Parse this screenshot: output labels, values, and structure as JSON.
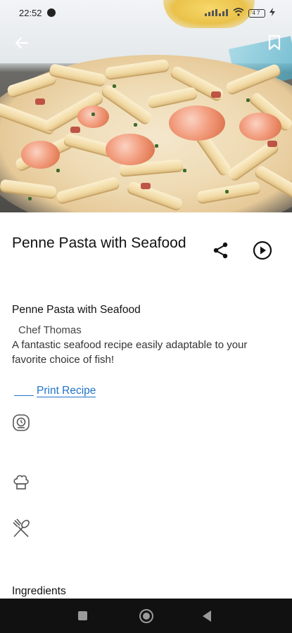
{
  "status_bar": {
    "time": "22:52",
    "battery": "47",
    "signal_icons": [
      "wifi-icon",
      "signal-icon",
      "battery-icon",
      "charging-icon"
    ]
  },
  "header": {
    "back_icon": "arrow-left-icon",
    "bookmark_icon": "bookmark-icon"
  },
  "recipe": {
    "title": "Penne Pasta with Seafood",
    "subtitle": "Penne Pasta with Seafood",
    "chef": "Chef Thomas",
    "description": "A fantastic seafood recipe easily adaptable to your favorite choice of fish!",
    "print_label": "Print Recipe",
    "section_heading": "Ingredients"
  },
  "actions": {
    "share_icon": "share-icon",
    "play_icon": "play-circle-icon"
  },
  "info_icons": [
    "timer-icon",
    "chef-hat-icon",
    "fork-spoon-icon"
  ],
  "nav": {
    "icons": [
      "recent-apps-icon",
      "home-icon",
      "back-icon"
    ]
  },
  "colors": {
    "link": "#1f73c9",
    "nav_bg": "#111111"
  }
}
